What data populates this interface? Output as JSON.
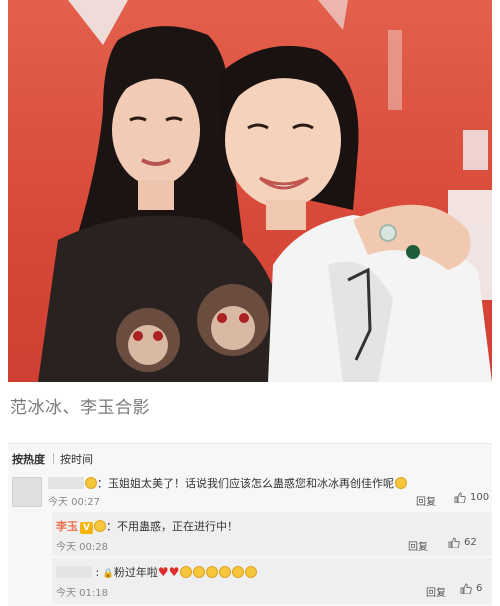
{
  "caption": "范冰冰、李玉合影",
  "comments": {
    "sort_tabs": [
      {
        "label": "按热度",
        "active": true
      },
      {
        "label": "按时间",
        "active": false
      }
    ],
    "items": [
      {
        "text": "：玉姐姐太美了！话说我们应该怎么蛊惑您和冰冰再创佳作呢",
        "emoji": "smiling-face-emoji",
        "time": "今天 00:27",
        "reply_label": "回复",
        "likes": "100",
        "replies": [
          {
            "user": "李玉",
            "vip_badge": "V",
            "text": "：不用蛊惑，正在进行中！",
            "time": "今天 00:28",
            "reply_label": "回复",
            "likes": "62"
          },
          {
            "text": "粉过年啦",
            "reaction_emojis": [
              "heart",
              "heart",
              "smile",
              "smile",
              "smile",
              "grin",
              "grin",
              "grin"
            ],
            "time": "今天 01:18",
            "reply_label": "回复",
            "likes": "6"
          }
        ]
      }
    ]
  },
  "colors": {
    "background": "#ffffff",
    "panel": "#f7f7f7",
    "reply_panel": "#efefef",
    "username": "#eb7350",
    "photo_backdrop": "#d94a3a"
  }
}
